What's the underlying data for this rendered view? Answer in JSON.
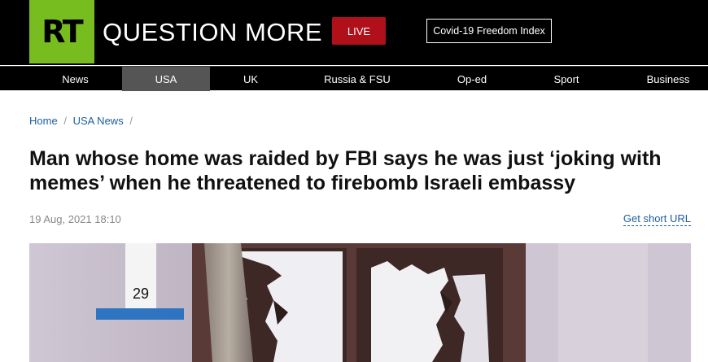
{
  "header": {
    "logo_text": "RT",
    "tagline": "QUESTION MORE",
    "live_label": "LIVE",
    "covid_index_label": "Covid-19 Freedom Index"
  },
  "nav": {
    "items": [
      {
        "label": "News"
      },
      {
        "label": "USA"
      },
      {
        "label": "UK"
      },
      {
        "label": "Russia & FSU"
      },
      {
        "label": "Op-ed"
      },
      {
        "label": "Sport"
      },
      {
        "label": "Business"
      }
    ],
    "active": "USA"
  },
  "breadcrumb": {
    "home": "Home",
    "section": "USA News",
    "separator": "/"
  },
  "article": {
    "headline": "Man whose home was raided by FBI says he was just ‘joking with memes’ when he threatened to firebomb Israeli embassy",
    "date": "19 Aug, 2021 18:10",
    "short_url_label": "Get short URL",
    "photo": {
      "evidence_marker": "29"
    }
  },
  "colors": {
    "brand_green": "#77bd1f",
    "live_red": "#b0101a",
    "link_blue": "#1b5e9e",
    "header_black": "#000000"
  }
}
